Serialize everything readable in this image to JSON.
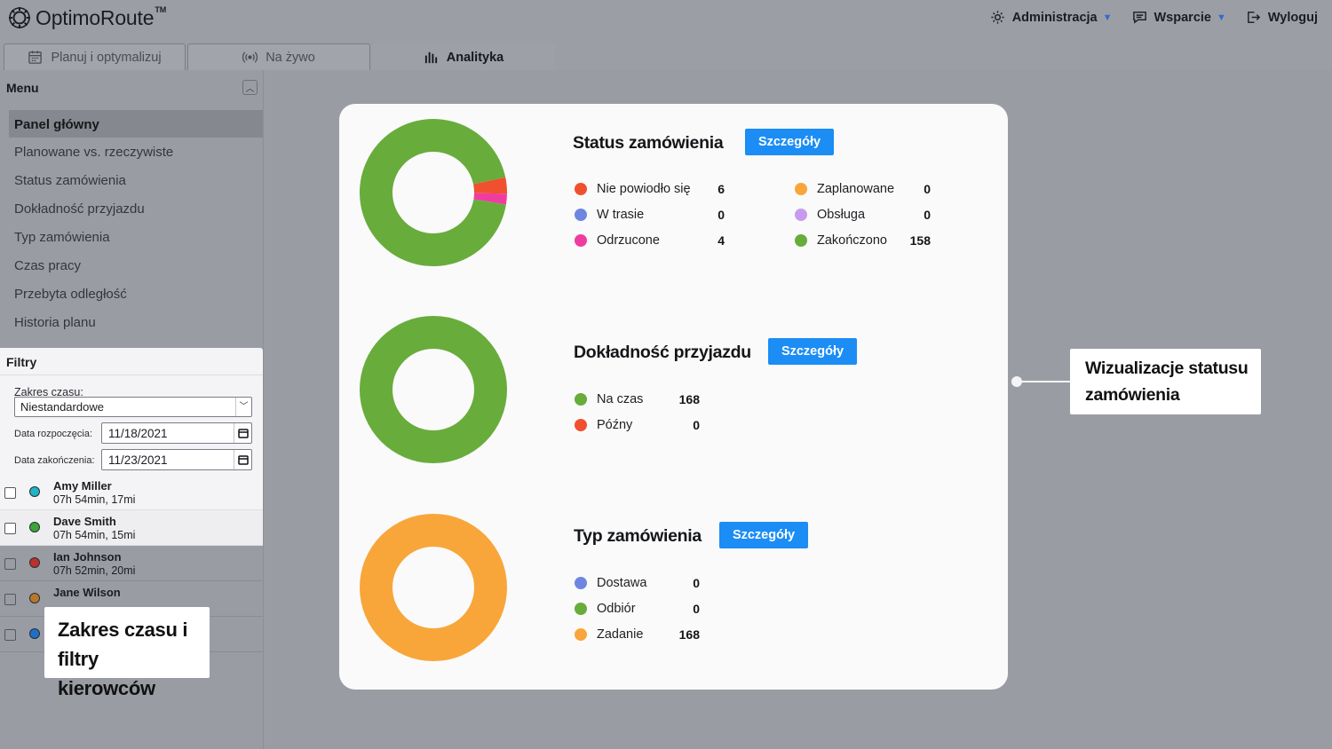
{
  "app": {
    "logo_text": "OptimoRoute",
    "logo_tm": "TM"
  },
  "topnav": {
    "admin": "Administracja",
    "support": "Wsparcie",
    "logout": "Wyloguj"
  },
  "tabs": [
    {
      "label": "Planuj i optymalizuj",
      "icon": "calendar-icon"
    },
    {
      "label": "Na żywo",
      "icon": "broadcast-icon"
    },
    {
      "label": "Analityka",
      "icon": "bar-chart-icon",
      "active": true
    }
  ],
  "sidebar": {
    "menu_title": "Menu",
    "items": [
      {
        "label": "Panel główny",
        "active": true
      },
      {
        "label": "Planowane vs. rzeczywiste"
      },
      {
        "label": "Status zamówienia"
      },
      {
        "label": "Dokładność przyjazdu"
      },
      {
        "label": "Typ zamówienia"
      },
      {
        "label": "Czas pracy"
      },
      {
        "label": "Przebyta odległość"
      },
      {
        "label": "Historia planu"
      }
    ]
  },
  "filters": {
    "title": "Filtry",
    "range_label": "Zakres czasu:",
    "range_value": "Niestandardowe",
    "start_label": "Data rozpoczęcia:",
    "start_value": "11/18/2021",
    "end_label": "Data zakończenia:",
    "end_value": "11/23/2021"
  },
  "drivers": [
    {
      "name": "Amy Miller",
      "stats": "07h 54min, 17mi",
      "color": "#1fb5c4"
    },
    {
      "name": "Dave Smith",
      "stats": "07h 54min, 15mi",
      "color": "#3aa637"
    },
    {
      "name": "Ian Johnson",
      "stats": "07h 52min, 20mi",
      "color": "#b8332c"
    },
    {
      "name": "Jane Wilson",
      "stats": "",
      "color": "#b8782c"
    },
    {
      "name": "",
      "stats": "",
      "color": "#1f6fc4"
    }
  ],
  "callouts": {
    "left": [
      "Zakres czasu i",
      "filtry kierowców"
    ],
    "right": [
      "Wizualizacje statusu",
      "zamówienia"
    ]
  },
  "details_label": "Szczegóły",
  "chart_data": [
    {
      "type": "pie",
      "title": "Status zamówienia",
      "categories": [
        "Nie powiodło się",
        "W trasie",
        "Odrzucone",
        "Zaplanowane",
        "Obsługa",
        "Zakończono"
      ],
      "values": [
        6,
        0,
        4,
        0,
        0,
        158
      ],
      "colors": [
        "#f0502f",
        "#6e86e0",
        "#f03ca0",
        "#f8a63a",
        "#c79af0",
        "#68ac3c"
      ],
      "donut": true
    },
    {
      "type": "pie",
      "title": "Dokładność przyjazdu",
      "categories": [
        "Na czas",
        "Późny"
      ],
      "values": [
        168,
        0
      ],
      "colors": [
        "#68ac3c",
        "#f0502f"
      ],
      "donut": true
    },
    {
      "type": "pie",
      "title": "Typ zamówienia",
      "categories": [
        "Dostawa",
        "Odbiór",
        "Zadanie"
      ],
      "values": [
        0,
        0,
        168
      ],
      "colors": [
        "#6e86e0",
        "#68ac3c",
        "#f8a63a"
      ],
      "donut": true
    }
  ]
}
